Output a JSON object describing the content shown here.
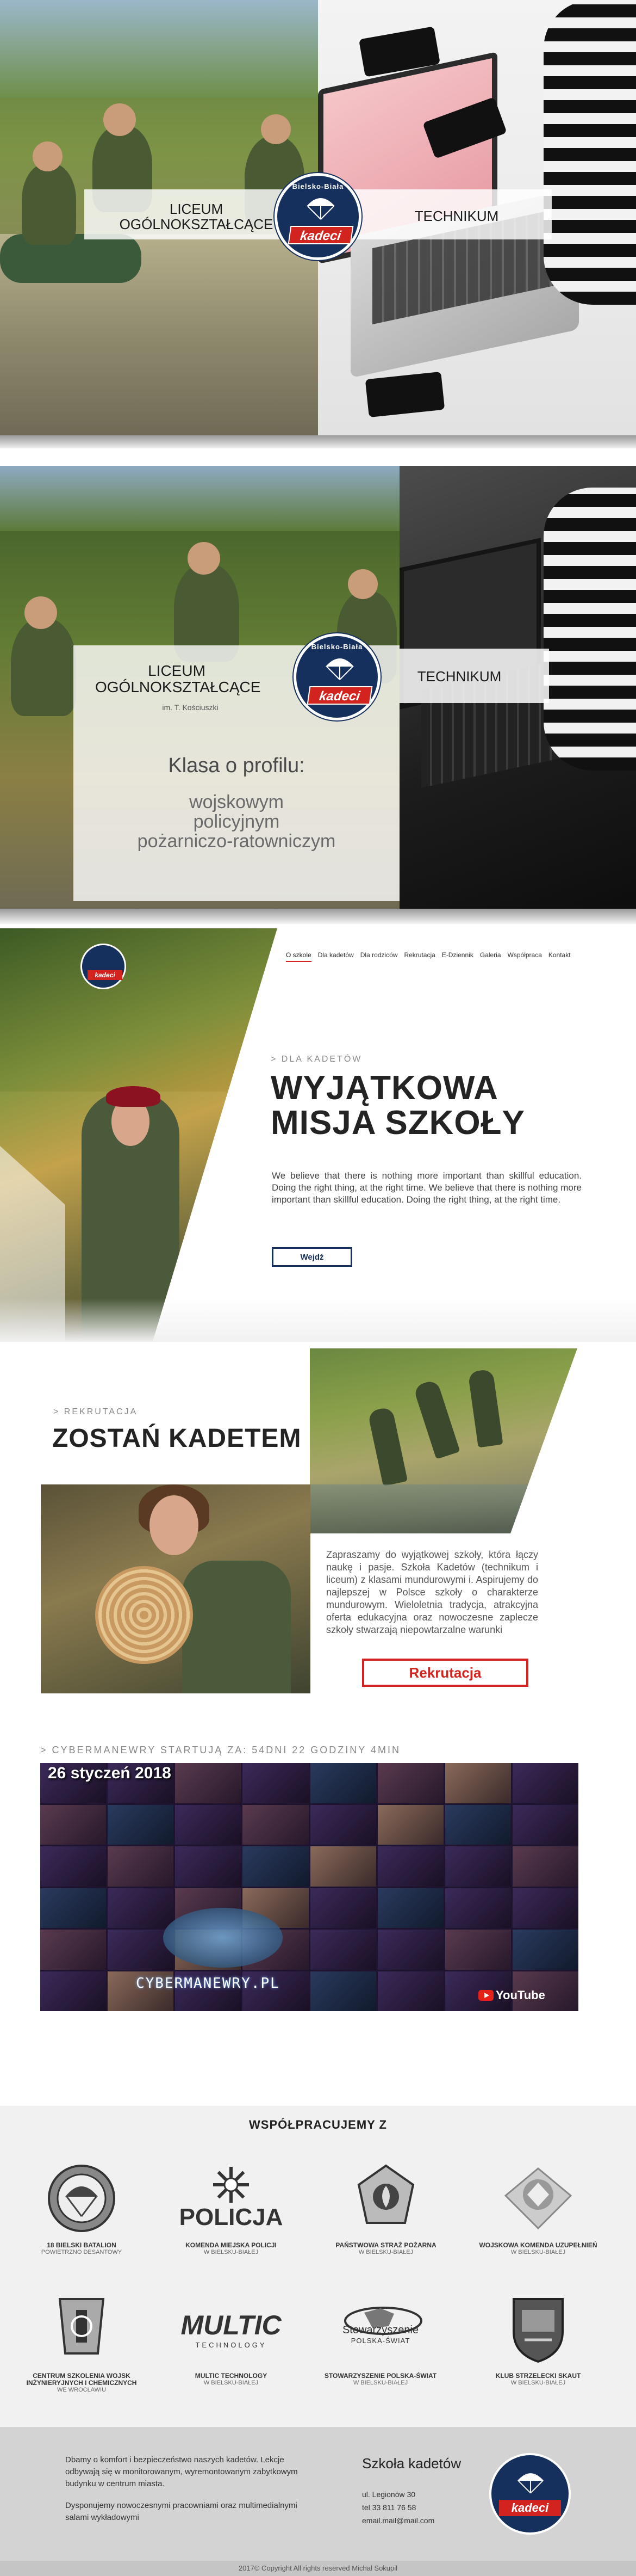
{
  "hero1": {
    "left_title": "LICEUM OGÓLNOKSZTAŁCĄCE",
    "right_title": "TECHNIKUM",
    "logo_ring": "Bielsko-Biała",
    "logo_word": "kadeci"
  },
  "hero2": {
    "left_title": "LICEUM OGÓLNOKSZTAŁCĄCE",
    "left_subtitle": "im. T. Kościuszki",
    "right_title": "TECHNIKUM",
    "profile_title": "Klasa o profilu:",
    "profiles": [
      "wojskowym",
      "policyjnym",
      "pożarniczo-ratowniczym"
    ]
  },
  "school": {
    "nav": [
      "O szkole",
      "Dla kadetów",
      "Dla rodziców",
      "Rekrutacja",
      "E-Dziennik",
      "Galeria",
      "Współpraca",
      "Kontakt"
    ],
    "eyebrow": "> DLA KADETÓW",
    "title": "WYJĄTKOWA MISJA SZKOŁY",
    "text": "We believe that there is nothing more important than skillful education. Doing the right thing, at the right time. We believe that there is nothing more important than skillful education. Doing the right thing, at the right time.",
    "button": "Wejdź"
  },
  "recruit": {
    "eyebrow": "> REKRUTACJA",
    "title": "ZOSTAŃ KADETEM",
    "text": "Zapraszamy do wyjątkowej szkoły, która łączy naukę i pasje. Szkoła Kadetów (technikum i liceum) z klasami mundurowymi i. Aspirujemy do najlepszej w Polsce szkoły o charakterze mundurowym. Wieloletnia tradycja, atrakcyjna oferta edukacyjna oraz nowoczesne zaplecze szkoły stwarzają niepowtarzalne warunki",
    "button": "Rekrutacja"
  },
  "cyber": {
    "countdown": "> CYBERMANEWRY STARTUJĄ ZA: 54DNI 22 GODZINY 4MIN",
    "date": "26 styczeń 2018",
    "logo": "CYBERMANEWRY.PL",
    "youtube": "YouTube"
  },
  "partners": {
    "title": "WSPÓŁPRACUJEMY Z",
    "items": [
      {
        "name": "18 BIELSKI BATALION",
        "sub": "POWIETRZNO DESANTOWY",
        "icon": "para-badge-icon"
      },
      {
        "name": "KOMENDA MIEJSKA POLICJI",
        "sub": "W BIELSKU-BIAŁEJ",
        "icon": "police-star-icon",
        "word": "POLICJA"
      },
      {
        "name": "PAŃSTWOWA STRAŻ POŻARNA",
        "sub": "W BIELSKU-BIAŁEJ",
        "icon": "fire-badge-icon"
      },
      {
        "name": "WOJSKOWA KOMENDA UZUPEŁNIEŃ",
        "sub": "W BIELSKU-BIAŁEJ",
        "icon": "eagle-badge-icon"
      },
      {
        "name": "CENTRUM SZKOLENIA WOJSK INŻYNIERYJNYCH I CHEMICZNYCH",
        "sub": "WE WROCŁAWIU",
        "icon": "engineer-badge-icon"
      },
      {
        "name": "MULTIC TECHNOLOGY",
        "sub": "W BIELSKU-BIAŁEJ",
        "icon": "multic-logo-icon",
        "word": "MULTIC",
        "word_sub": "TECHNOLOGY"
      },
      {
        "name": "STOWARZYSZENIE POLSKA-ŚWIAT",
        "sub": "W BIELSKU-BIAŁEJ",
        "icon": "globe-icon",
        "word": "Stowarzyszenie",
        "word_sub": "POLSKA-ŚWIAT"
      },
      {
        "name": "KLUB STRZELECKI SKAUT",
        "sub": "W BIELSKU-BIAŁEJ",
        "icon": "shield-badge-icon"
      }
    ]
  },
  "footer": {
    "para1": "Dbamy o komfort i bezpieczeństwo naszych kadetów. Lekcje odbywają się w monitorowanym, wyremontowanym zabytkowym budynku w centrum miasta.",
    "para2": "Dysponujemy nowoczesnymi pracowniami oraz multimedialnymi salami wykładowymi",
    "title": "Szkoła kadetów",
    "address": "ul. Legionów 30",
    "phone": "tel 33 811 76 58",
    "email": "email.mail@mail.com",
    "copyright": "2017© Copyright All rights reserved   Michał Sokupil",
    "logo_word": "kadeci"
  },
  "colors": {
    "navy": "#16305e",
    "red": "#d3231e"
  }
}
